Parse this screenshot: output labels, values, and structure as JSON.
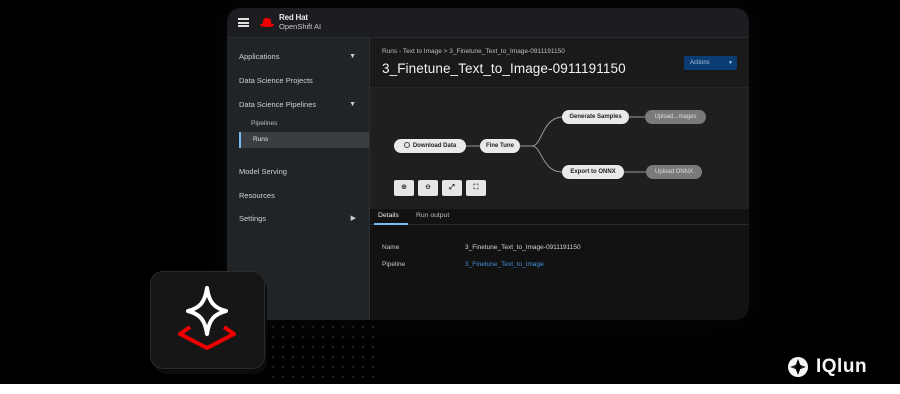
{
  "masthead": {
    "brand_line1": "Red Hat",
    "brand_line2": "OpenShift AI",
    "menu_icon": "hamburger-icon"
  },
  "sidebar": {
    "items": [
      {
        "label": "Applications",
        "has_caret": "down"
      },
      {
        "label": "Data Science Projects"
      },
      {
        "label": "Data Science Pipelines",
        "has_caret": "down"
      },
      {
        "label": "Model Serving"
      },
      {
        "label": "Resources"
      },
      {
        "label": "Settings",
        "has_caret": "right"
      }
    ],
    "sub_items": [
      {
        "label": "Pipelines"
      },
      {
        "label": "Runs",
        "active": true
      }
    ]
  },
  "header": {
    "breadcrumb": "Runs - Text to Image >  3_Finetune_Text_to_Image-0911191150",
    "title": "3_Finetune_Text_to_Image-0911191150",
    "actions_label": "Actions"
  },
  "graph": {
    "nodes": [
      {
        "label": "Download Data",
        "status": "running"
      },
      {
        "label": "Fine Tune",
        "status": "done"
      },
      {
        "label": "Generate Samples",
        "status": "done"
      },
      {
        "label": "Upload...mages",
        "status": "pending"
      },
      {
        "label": "Export to ONNX",
        "status": "done"
      },
      {
        "label": "Upload ONNX",
        "status": "pending"
      }
    ],
    "controls": [
      "zoom-in-icon",
      "zoom-out-icon",
      "fit-to-screen-icon",
      "expand-icon"
    ]
  },
  "tabs": [
    {
      "label": "Details",
      "active": true
    },
    {
      "label": "Run output"
    }
  ],
  "details": [
    {
      "label": "Name",
      "value": "3_Finetune_Text_to_Image-0911191150"
    },
    {
      "label": "Pipeline",
      "value": "3_Finetune_Text_to_Image"
    }
  ],
  "colors": {
    "accent_blue": "#73bcf7",
    "link_blue": "#3f8fd9",
    "red_hat_red": "#ee0000"
  },
  "watermark": {
    "text": "IQlun"
  }
}
